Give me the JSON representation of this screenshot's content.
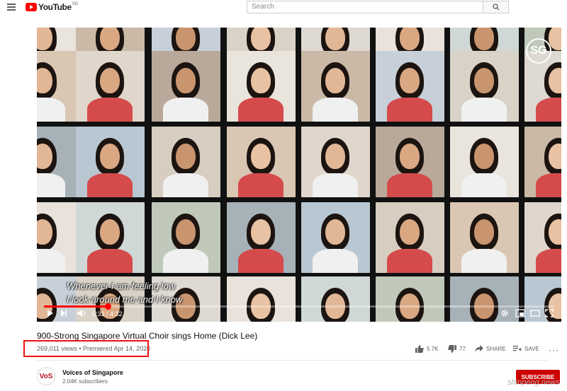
{
  "header": {
    "logo_text": "YouTube",
    "logo_region": "SG",
    "search_placeholder": "Search"
  },
  "video": {
    "overlay_logo": "SG",
    "subtitles": [
      "Whenever I am feeling low",
      "I look around me and I know"
    ],
    "progress_fraction": 0.125,
    "time_display": "0:33 / 4:32"
  },
  "info": {
    "title": "900-Strong Singapore Virtual Choir sings Home (Dick Lee)",
    "views": "269,011 views",
    "premiered": "Premiered Apr 14, 2020",
    "likes": "5.7K",
    "dislikes": "77",
    "share_label": "SHARE",
    "save_label": "SAVE"
  },
  "channel": {
    "name": "Voices of Singapore",
    "subscribers": "2.04K subscribers",
    "avatar_text": "VoS",
    "subscribe_label": "SUBSCRIBE"
  },
  "watermark": "shinpeng.news",
  "colors": {
    "accent": "#ff0000",
    "subscribe": "#cc0000",
    "highlight": "#e11111"
  }
}
